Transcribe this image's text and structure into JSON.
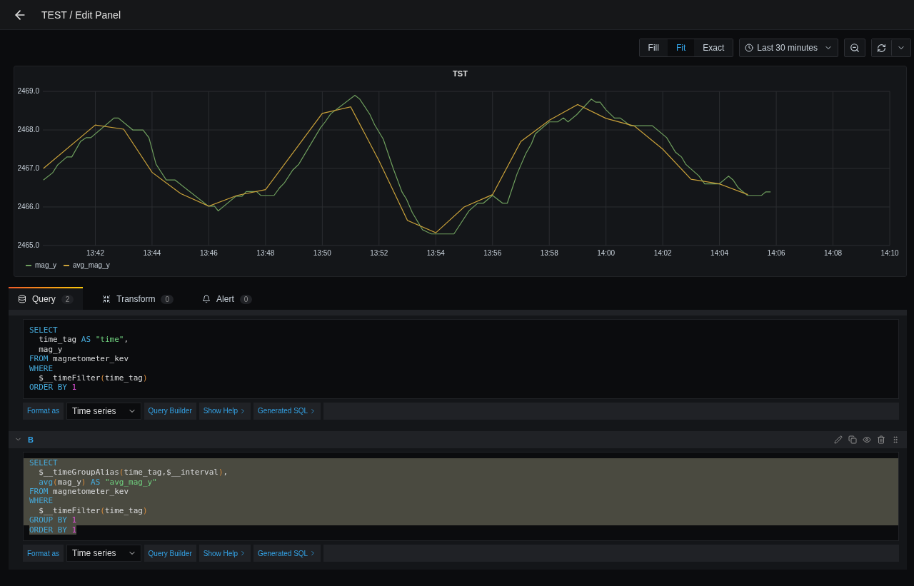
{
  "header": {
    "title": "TEST / Edit Panel"
  },
  "display_modes": [
    {
      "label": "Fill",
      "selected": false
    },
    {
      "label": "Fit",
      "selected": true
    },
    {
      "label": "Exact",
      "selected": false
    }
  ],
  "time_range": {
    "label": "Last 30 minutes"
  },
  "panel": {
    "chart_data": {
      "type": "line",
      "title": "TST",
      "grid": true,
      "xlim": [
        820.15,
        850
      ],
      "ylim": [
        2465,
        2469
      ],
      "yticks": [
        {
          "value": 2465,
          "label": "2465.0"
        },
        {
          "value": 2466,
          "label": "2466.0"
        },
        {
          "value": 2467,
          "label": "2467.0"
        },
        {
          "value": 2468,
          "label": "2468.0"
        },
        {
          "value": 2469,
          "label": "2469.0"
        }
      ],
      "xticks": [
        {
          "value": 822,
          "label": "13:42"
        },
        {
          "value": 824,
          "label": "13:44"
        },
        {
          "value": 826,
          "label": "13:46"
        },
        {
          "value": 828,
          "label": "13:48"
        },
        {
          "value": 830,
          "label": "13:50"
        },
        {
          "value": 832,
          "label": "13:52"
        },
        {
          "value": 834,
          "label": "13:54"
        },
        {
          "value": 836,
          "label": "13:56"
        },
        {
          "value": 838,
          "label": "13:58"
        },
        {
          "value": 840,
          "label": "14:00"
        },
        {
          "value": 842,
          "label": "14:02"
        },
        {
          "value": 844,
          "label": "14:04"
        },
        {
          "value": 846,
          "label": "14:06"
        },
        {
          "value": 848,
          "label": "14:08"
        },
        {
          "value": 850,
          "label": "14:10"
        }
      ],
      "series": [
        {
          "name": "mag_y",
          "color": "#6f9f5e",
          "x": [
            820.17,
            820.5,
            820.67,
            821.0,
            821.17,
            821.48,
            821.68,
            821.84,
            822.66,
            822.81,
            823.32,
            823.68,
            823.89,
            824.14,
            824.5,
            824.81,
            825.99,
            826.2,
            826.33,
            826.96,
            827.17,
            827.32,
            827.68,
            827.83,
            828.3,
            828.5,
            828.66,
            828.96,
            829.17,
            829.94,
            830.1,
            830.3,
            831.15,
            831.32,
            831.68,
            831.84,
            832.15,
            832.5,
            832.81,
            832.97,
            833.17,
            833.53,
            833.84,
            834.64,
            835.17,
            835.48,
            835.68,
            836.0,
            836.35,
            836.52,
            836.86,
            837.17,
            837.37,
            837.51,
            838.0,
            838.3,
            838.5,
            838.66,
            838.97,
            839.48,
            839.64,
            839.79,
            840.0,
            840.3,
            840.5,
            840.86,
            841.63,
            842.14,
            842.45,
            842.66,
            842.81,
            843.27,
            843.48,
            843.99,
            844.32,
            844.48,
            844.66,
            844.98,
            845.48,
            845.63,
            845.8
          ],
          "values": [
            2466.7,
            2466.89,
            2467.09,
            2467.3,
            2467.3,
            2467.7,
            2467.8,
            2467.8,
            2468.31,
            2468.31,
            2468.0,
            2468.0,
            2467.8,
            2467.11,
            2466.7,
            2466.7,
            2466.02,
            2466.02,
            2465.9,
            2466.28,
            2466.28,
            2466.4,
            2466.4,
            2466.3,
            2466.3,
            2466.5,
            2466.62,
            2466.96,
            2467.11,
            2468.06,
            2468.21,
            2468.42,
            2468.9,
            2468.8,
            2468.4,
            2468.14,
            2467.76,
            2467.0,
            2466.39,
            2466.2,
            2465.86,
            2465.41,
            2465.3,
            2465.3,
            2465.9,
            2466.1,
            2466.1,
            2466.3,
            2466.1,
            2466.1,
            2466.85,
            2467.38,
            2467.64,
            2467.9,
            2468.21,
            2468.21,
            2468.31,
            2468.21,
            2468.4,
            2468.8,
            2468.72,
            2468.72,
            2468.52,
            2468.31,
            2468.31,
            2468.11,
            2468.11,
            2467.8,
            2467.42,
            2467.3,
            2467.11,
            2466.81,
            2466.6,
            2466.6,
            2466.8,
            2466.7,
            2466.5,
            2466.3,
            2466.3,
            2466.39,
            2466.39
          ]
        },
        {
          "name": "avg_mag_y",
          "color": "#c9a13a",
          "x": [
            820.17,
            822,
            823,
            824,
            825,
            826,
            827,
            828,
            830,
            831,
            832,
            833,
            834,
            835,
            836,
            837,
            838,
            839,
            840,
            841,
            842,
            843,
            844,
            845
          ],
          "values": [
            2467.0,
            2468.13,
            2468.02,
            2466.9,
            2466.35,
            2466.02,
            2466.3,
            2466.45,
            2468.43,
            2468.6,
            2467.2,
            2465.65,
            2465.33,
            2466.0,
            2466.32,
            2467.7,
            2468.25,
            2468.66,
            2468.3,
            2468.1,
            2467.5,
            2466.72,
            2466.6,
            2466.32
          ]
        }
      ]
    }
  },
  "tabs": [
    {
      "label": "Query",
      "count": "2",
      "kind": "query",
      "selected": true
    },
    {
      "label": "Transform",
      "count": "0",
      "kind": "transform",
      "selected": false
    },
    {
      "label": "Alert",
      "count": "0",
      "kind": "alert",
      "selected": false
    }
  ],
  "queries": [
    {
      "highlighted": false,
      "format_label": "Format as",
      "format": "Time series",
      "buttons": [
        {
          "label": "Query Builder",
          "kind": "plain"
        },
        {
          "label": "Show Help",
          "kind": "expander"
        },
        {
          "label": "Generated SQL",
          "kind": "expander"
        }
      ],
      "code": [
        {
          "indent": false,
          "tokens": [
            {
              "kind": "keyword",
              "text": "SELECT"
            }
          ]
        },
        {
          "indent": true,
          "tokens": [
            {
              "kind": "plain",
              "text": "time_tag "
            },
            {
              "kind": "keyword",
              "text": "AS "
            },
            {
              "kind": "string",
              "text": "\"time\""
            },
            {
              "kind": "plain",
              "text": ","
            }
          ]
        },
        {
          "indent": true,
          "tokens": [
            {
              "kind": "plain",
              "text": "mag_y"
            }
          ]
        },
        {
          "indent": false,
          "tokens": [
            {
              "kind": "keyword",
              "text": "FROM"
            },
            {
              "kind": "plain",
              "text": " magnetometer_kev"
            }
          ]
        },
        {
          "indent": false,
          "tokens": [
            {
              "kind": "keyword",
              "text": "WHERE"
            }
          ]
        },
        {
          "indent": true,
          "tokens": [
            {
              "kind": "plain",
              "text": "$__timeFilter"
            },
            {
              "kind": "paren",
              "text": "("
            },
            {
              "kind": "plain",
              "text": "time_tag"
            },
            {
              "kind": "paren",
              "text": ")"
            }
          ]
        },
        {
          "indent": false,
          "tokens": [
            {
              "kind": "keyword",
              "text": "ORDER BY "
            },
            {
              "kind": "number",
              "text": "1"
            }
          ]
        }
      ]
    },
    {
      "name": "B",
      "expanded": true,
      "highlighted": true,
      "format_label": "Format as",
      "format": "Time series",
      "buttons": [
        {
          "label": "Query Builder",
          "kind": "plain"
        },
        {
          "label": "Show Help",
          "kind": "expander"
        },
        {
          "label": "Generated SQL",
          "kind": "expander"
        }
      ],
      "code": [
        {
          "indent": false,
          "tokens": [
            {
              "kind": "keyword",
              "text": "SELECT"
            }
          ]
        },
        {
          "indent": true,
          "tokens": [
            {
              "kind": "plain",
              "text": "$__timeGroupAlias"
            },
            {
              "kind": "paren",
              "text": "("
            },
            {
              "kind": "plain",
              "text": "time_tag,$__interval"
            },
            {
              "kind": "paren",
              "text": ")"
            },
            {
              "kind": "plain",
              "text": ","
            }
          ]
        },
        {
          "indent": true,
          "tokens": [
            {
              "kind": "keyword",
              "text": "avg"
            },
            {
              "kind": "paren",
              "text": "("
            },
            {
              "kind": "plain",
              "text": "mag_y"
            },
            {
              "kind": "paren",
              "text": ")"
            },
            {
              "kind": "keyword",
              "text": " AS "
            },
            {
              "kind": "string",
              "text": "\"avg_mag_y\""
            }
          ]
        },
        {
          "indent": false,
          "tokens": [
            {
              "kind": "keyword",
              "text": "FROM"
            },
            {
              "kind": "plain",
              "text": " magnetometer_kev"
            }
          ]
        },
        {
          "indent": false,
          "tokens": [
            {
              "kind": "keyword",
              "text": "WHERE"
            }
          ]
        },
        {
          "indent": true,
          "tokens": [
            {
              "kind": "plain",
              "text": "$__timeFilter"
            },
            {
              "kind": "paren",
              "text": "("
            },
            {
              "kind": "plain",
              "text": "time_tag"
            },
            {
              "kind": "paren",
              "text": ")"
            }
          ]
        },
        {
          "indent": false,
          "tokens": [
            {
              "kind": "keyword",
              "text": "GROUP BY "
            },
            {
              "kind": "number",
              "text": "1"
            }
          ]
        },
        {
          "indent": false,
          "tokens": [
            {
              "kind": "keyword",
              "text": "ORDER BY "
            },
            {
              "kind": "number",
              "text": "1"
            }
          ]
        }
      ]
    }
  ]
}
